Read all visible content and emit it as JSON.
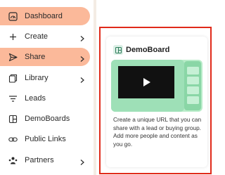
{
  "sidebar": {
    "items": [
      {
        "label": "Dashboard",
        "icon": "dashboard-gauge-icon",
        "has_chevron": false,
        "state": "highlight"
      },
      {
        "label": "Create",
        "icon": "plus-icon",
        "has_chevron": true,
        "state": "normal"
      },
      {
        "label": "Share",
        "icon": "send-icon",
        "has_chevron": true,
        "state": "highlight"
      },
      {
        "label": "Library",
        "icon": "library-icon",
        "has_chevron": true,
        "state": "normal"
      },
      {
        "label": "Leads",
        "icon": "filter-lines-icon",
        "has_chevron": false,
        "state": "normal"
      },
      {
        "label": "DemoBoards",
        "icon": "board-layout-icon",
        "has_chevron": false,
        "state": "normal"
      },
      {
        "label": "Public Links",
        "icon": "link-icon",
        "has_chevron": false,
        "state": "normal"
      },
      {
        "label": "Partners",
        "icon": "partners-icon",
        "has_chevron": true,
        "state": "normal"
      }
    ]
  },
  "popover": {
    "title": "DemoBoard",
    "icon": "demoboard-icon",
    "description": "Create a unique URL that you can share with a lead or buying group. Add more people and content as you go."
  },
  "colors": {
    "highlight": "#fbb99a",
    "outline": "#e02a1a",
    "preview_green": "#9ee0b7",
    "video_black": "#111111"
  }
}
